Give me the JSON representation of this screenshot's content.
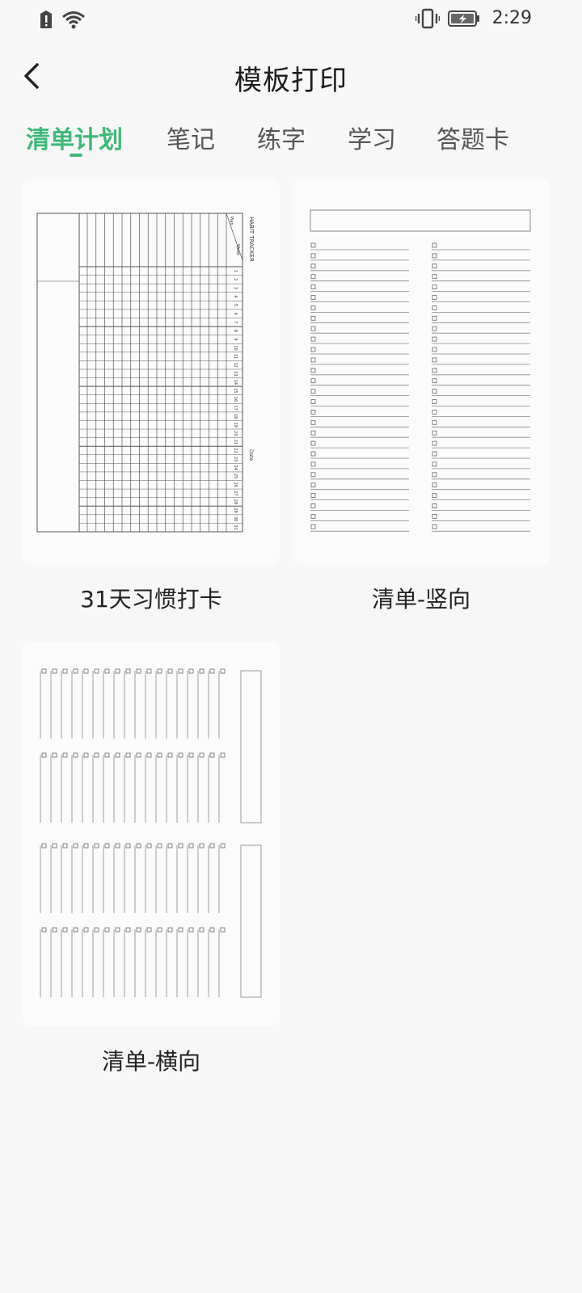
{
  "status_bar": {
    "time": "2:29",
    "icons": [
      "alert-icon",
      "wifi-icon",
      "vibrate-icon",
      "battery-icon"
    ]
  },
  "app_bar": {
    "title": "模板打印",
    "back_icon": "back-arrow-icon"
  },
  "tabs": [
    {
      "label": "清单计划",
      "active": true
    },
    {
      "label": "笔记",
      "active": false
    },
    {
      "label": "练字",
      "active": false
    },
    {
      "label": "学习",
      "active": false
    },
    {
      "label": "答题卡",
      "active": false
    }
  ],
  "templates": [
    {
      "label": "31天习惯打卡",
      "preview": {
        "title": "HABIT TRACKER",
        "header_labels": [
          "Plan",
          "Week"
        ],
        "footer_label": "Date",
        "days": [
          "1",
          "2",
          "3",
          "4",
          "5",
          "6",
          "7",
          "8",
          "9",
          "10",
          "11",
          "12",
          "13",
          "14",
          "15",
          "16",
          "17",
          "18",
          "19",
          "20",
          "21",
          "22",
          "23",
          "24",
          "25",
          "26",
          "27",
          "28",
          "29",
          "30",
          "31"
        ]
      }
    },
    {
      "label": "清单-竖向"
    },
    {
      "label": "清单-横向"
    }
  ],
  "colors": {
    "accent": "#3cb978",
    "background": "#f7f7f7",
    "card": "#fbfbfb"
  }
}
